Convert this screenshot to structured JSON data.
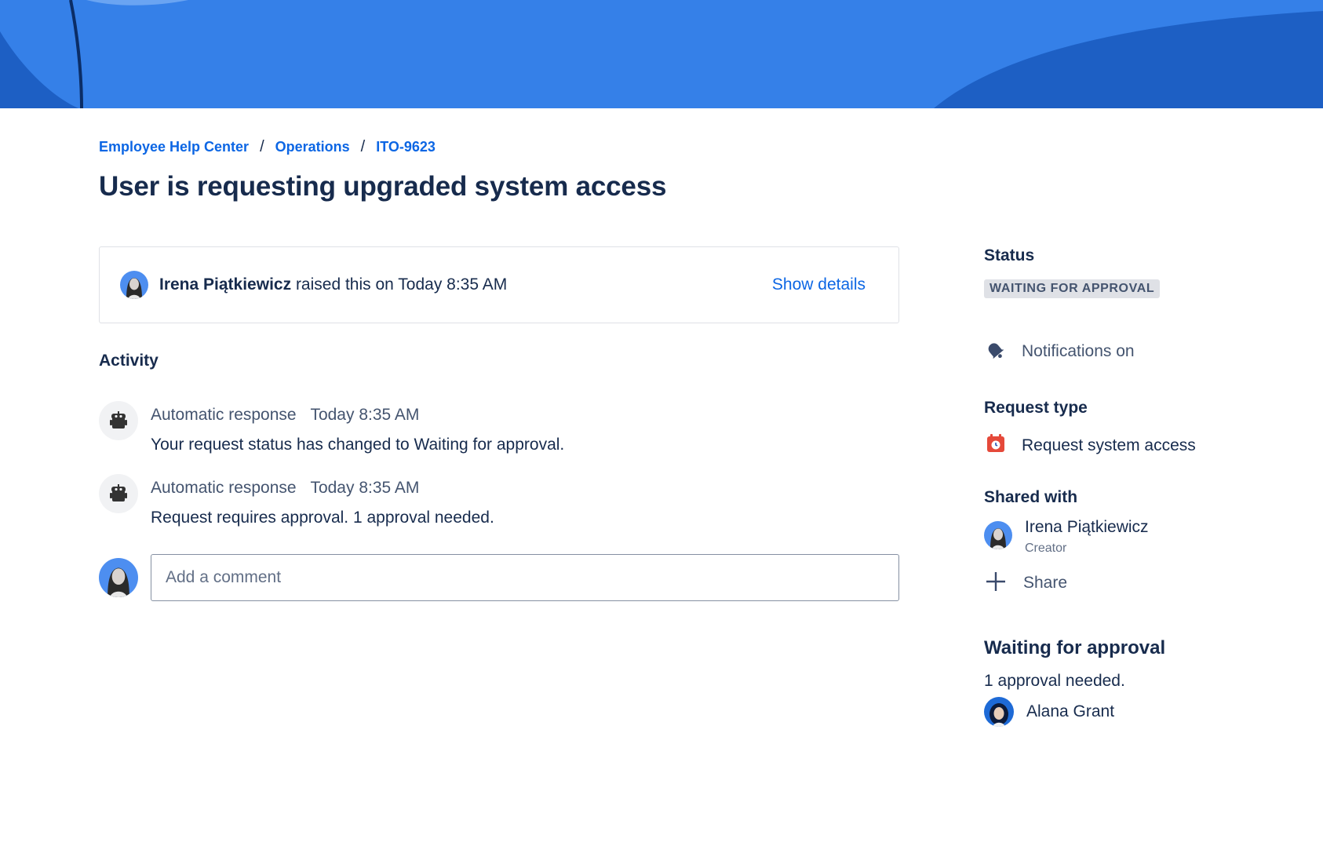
{
  "colors": {
    "banner_primary": "#3580e8",
    "banner_dark": "#1d5fc4",
    "link": "#0c66e4",
    "text": "#172b4d",
    "subtle_text": "#44546f",
    "lozenge_bg": "#dfe1e6",
    "request_type_icon": "#e5493a"
  },
  "breadcrumb": {
    "items": [
      {
        "label": "Employee Help Center"
      },
      {
        "label": "Operations"
      },
      {
        "label": "ITO-9623"
      }
    ],
    "separator": "/"
  },
  "page": {
    "title": "User is requesting upgraded system access"
  },
  "request_summary": {
    "reporter": "Irena Piątkiewicz",
    "raised_text": "raised this on Today 8:35 AM",
    "show_details_label": "Show details"
  },
  "activity": {
    "heading": "Activity",
    "items": [
      {
        "author": "Automatic response",
        "time": "Today 8:35 AM",
        "text": "Your request status has changed to Waiting for approval.",
        "icon": "robot-icon"
      },
      {
        "author": "Automatic response",
        "time": "Today 8:35 AM",
        "text": "Request requires approval. 1 approval needed.",
        "icon": "robot-icon"
      }
    ],
    "comment_placeholder": "Add a comment"
  },
  "sidebar": {
    "status_label": "Status",
    "status_value": "WAITING FOR APPROVAL",
    "notifications_label": "Notifications on",
    "notifications_icon": "bell-icon",
    "request_type_label": "Request type",
    "request_type_value": "Request system access",
    "request_type_icon": "calendar-clock-icon",
    "shared_with_label": "Shared with",
    "shared_with": [
      {
        "name": "Irena Piątkiewicz",
        "role": "Creator"
      }
    ],
    "share_label": "Share",
    "share_icon": "plus-icon",
    "approval_title": "Waiting for approval",
    "approval_note": "1 approval needed.",
    "approvers": [
      {
        "name": "Alana Grant"
      }
    ]
  }
}
